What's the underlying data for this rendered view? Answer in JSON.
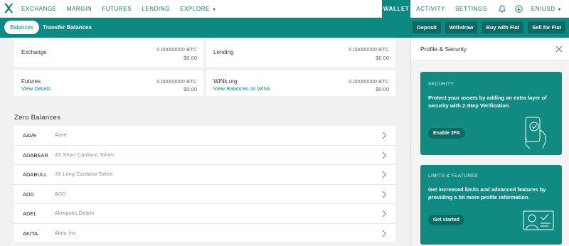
{
  "topnav": {
    "left_links": [
      "EXCHANGE",
      "MARGIN",
      "FUTURES",
      "LENDING",
      "EXPLORE"
    ],
    "right_links": {
      "wallet": "WALLET",
      "activity": "ACTIVITY",
      "settings": "SETTINGS",
      "locale": "EN/USD"
    },
    "icons": [
      "logo-icon",
      "bell-icon",
      "download-icon",
      "caret-down-icon"
    ]
  },
  "subnav": {
    "tabs": [
      "Balances",
      "Transfer Balances"
    ],
    "buttons": [
      "Deposit",
      "Withdraw",
      "Buy with Fiat",
      "Sell for Fiat"
    ]
  },
  "balances": [
    {
      "name": "Exchange",
      "btc": "0.00000000 BTC",
      "usd": "$0.00",
      "link": ""
    },
    {
      "name": "Lending",
      "btc": "0.00000000 BTC",
      "usd": "$0.00",
      "link": ""
    },
    {
      "name": "Futures",
      "btc": "0.00000000 BTC",
      "usd": "$0.00",
      "link": "View Details"
    },
    {
      "name": "WINk.org",
      "btc": "0.00000000 BTC",
      "usd": "$0.00",
      "link": "View Balances on WINk"
    }
  ],
  "zero_balances": {
    "title": "Zero Balances",
    "rows": [
      {
        "ticker": "AAVE",
        "name": "Aave"
      },
      {
        "ticker": "ADABEAR",
        "name": "3X Short Cardano Token"
      },
      {
        "ticker": "ADABULL",
        "name": "3X Long Cardano Token"
      },
      {
        "ticker": "ADD",
        "name": "ADD"
      },
      {
        "ticker": "ADEL",
        "name": "Akropolis Delphi"
      },
      {
        "ticker": "AKITA",
        "name": "Akita Inu"
      }
    ]
  },
  "panel": {
    "title": "Profile & Security",
    "security": {
      "label": "SECURITY",
      "text": "Protect your assets by adding an extra layer of security with 2-Step Verification.",
      "button": "Enable 2FA"
    },
    "limits": {
      "label": "LIMITS & FEATURES",
      "text": "Get increased limits and advanced features by providing a bit more profile information.",
      "button": "Get started"
    }
  },
  "colors": {
    "accent": "#0c8a81",
    "accent_dark": "#0a6b64",
    "card": "#118a82"
  }
}
